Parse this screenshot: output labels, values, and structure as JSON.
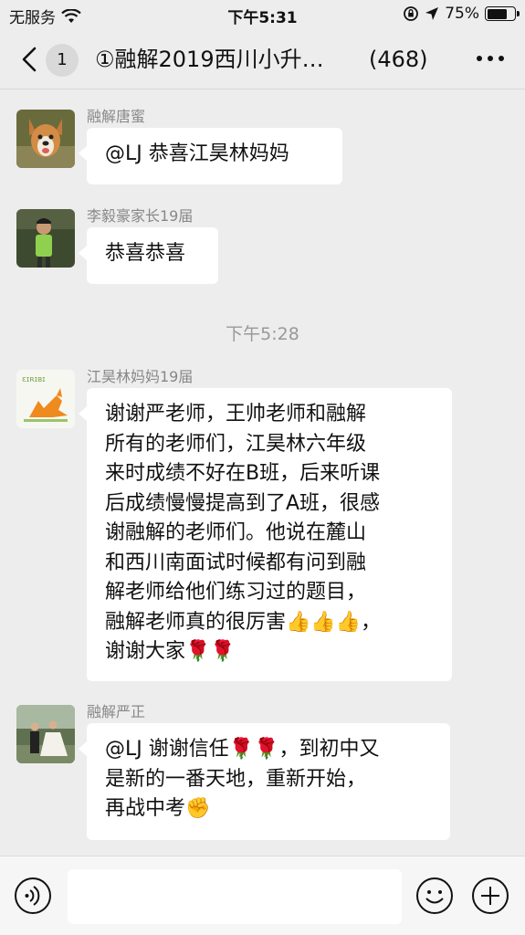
{
  "status": {
    "carrier": "无服务",
    "time": "下午5:31",
    "battery_text": "75%",
    "battery_level": 0.75
  },
  "nav": {
    "badge": "1",
    "title": "①融解2019西川小升…",
    "count": "(468)"
  },
  "messages": [
    {
      "sender": "融解唐蜜",
      "text": "@LJ 恭喜江昊林妈妈"
    },
    {
      "sender": "李毅豪家长19届",
      "text": "恭喜恭喜"
    },
    {
      "sender": "江昊林妈妈19届",
      "lines": [
        "谢谢严老师，王帅老师和融解",
        "所有的老师们，江昊林六年级",
        "来时成绩不好在B班，后来听课",
        "后成绩慢慢提高到了A班，很感",
        "谢融解的老师们。他说在麓山",
        "和西川南面试时候都有问到融",
        "解老师给他们练习过的题目，",
        "融解老师真的很厉害👍👍👍，",
        "谢谢大家🌹🌹"
      ]
    },
    {
      "sender": "融解严正",
      "lines": [
        "@LJ 谢谢信任🌹🌹，到初中又",
        "是新的一番天地，重新开始，",
        "再战中考✊"
      ]
    }
  ],
  "timestamp": "下午5:28",
  "icons": {
    "back": "chevron-left-icon",
    "more": "more-dots-icon",
    "voice": "voice-icon",
    "emoji": "emoji-icon",
    "plus": "plus-icon"
  }
}
